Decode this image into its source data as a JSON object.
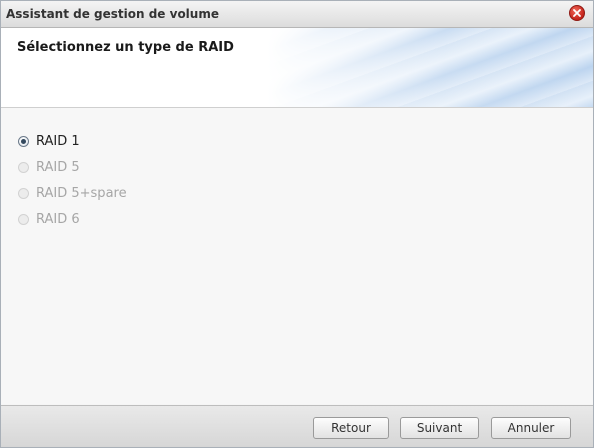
{
  "window": {
    "title": "Assistant de gestion de volume"
  },
  "header": {
    "title": "Sélectionnez un type de RAID"
  },
  "raid_options": [
    {
      "label": "RAID 1",
      "checked": true,
      "enabled": true
    },
    {
      "label": "RAID 5",
      "checked": false,
      "enabled": false
    },
    {
      "label": "RAID 5+spare",
      "checked": false,
      "enabled": false
    },
    {
      "label": "RAID 6",
      "checked": false,
      "enabled": false
    }
  ],
  "footer": {
    "back_label": "Retour",
    "next_label": "Suivant",
    "cancel_label": "Annuler"
  },
  "icons": {
    "close": "close-icon"
  },
  "colors": {
    "close_red": "#d8322a",
    "disabled_text": "#a6a6a6"
  }
}
